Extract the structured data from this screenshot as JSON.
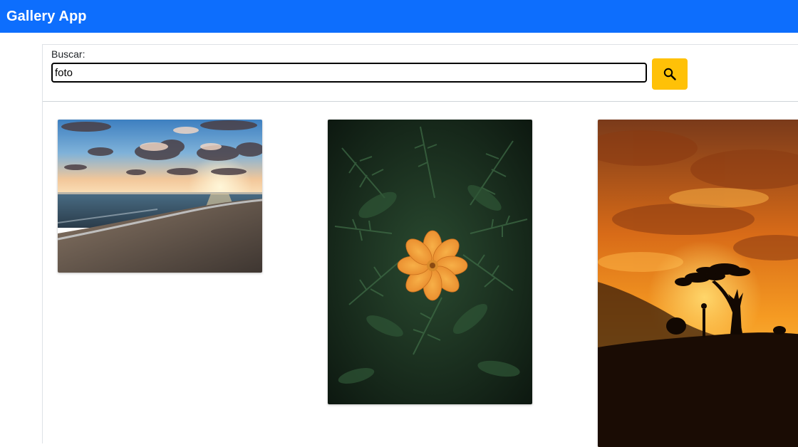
{
  "app": {
    "title": "Gallery App",
    "accent_color": "#0d6efd",
    "button_color": "#ffc107"
  },
  "search": {
    "label": "Buscar:",
    "value": "foto",
    "button_icon": "search-icon"
  },
  "gallery": {
    "photos": [
      {
        "subject": "beach-sunset"
      },
      {
        "subject": "orange-flower"
      },
      {
        "subject": "tree-silhouette-sunset"
      }
    ]
  }
}
